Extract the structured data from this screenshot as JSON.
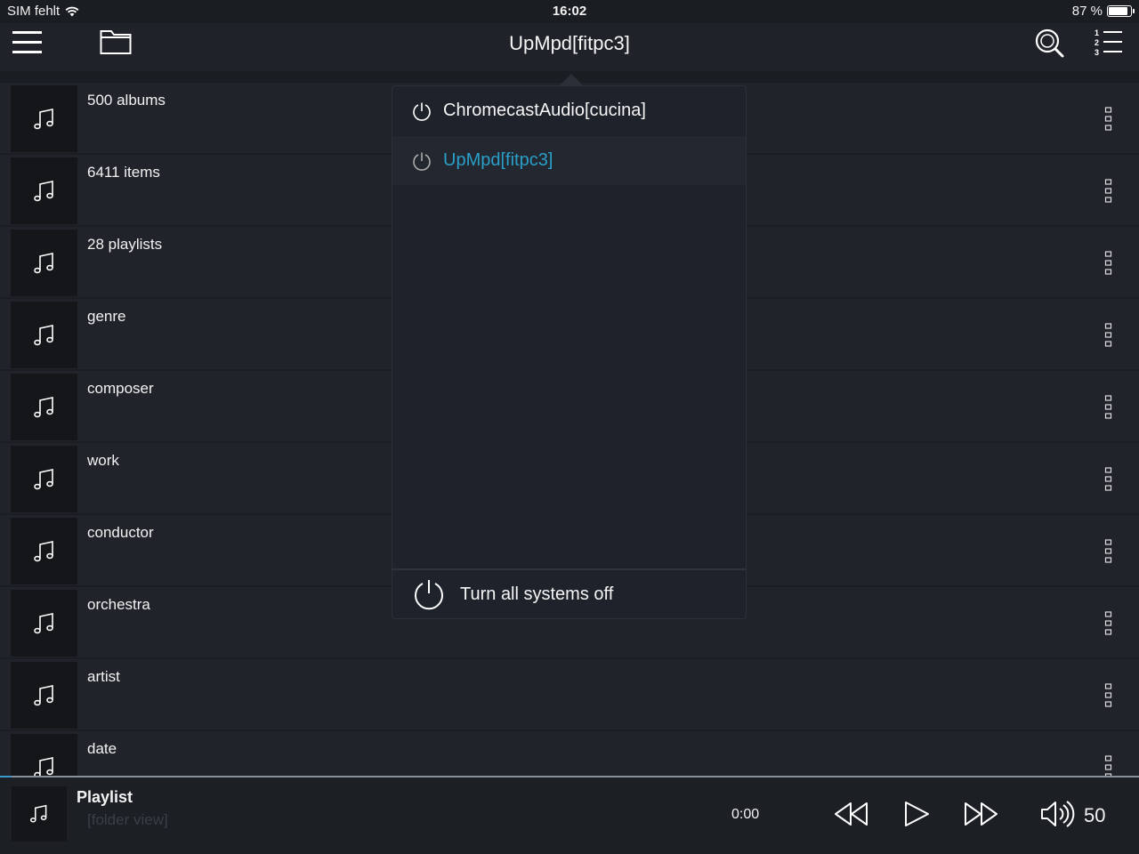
{
  "status_bar": {
    "carrier": "SIM fehlt",
    "time": "16:02",
    "battery": "87 %",
    "battery_level": 0.87
  },
  "navbar": {
    "title": "UpMpd[fitpc3]"
  },
  "list": {
    "items": [
      {
        "label": "500 albums"
      },
      {
        "label": "6411 items"
      },
      {
        "label": "28 playlists"
      },
      {
        "label": "genre"
      },
      {
        "label": "composer"
      },
      {
        "label": "work"
      },
      {
        "label": "conductor"
      },
      {
        "label": "orchestra"
      },
      {
        "label": "artist"
      },
      {
        "label": "date"
      }
    ]
  },
  "popover": {
    "items": [
      {
        "label": "ChromecastAudio[cucina]",
        "selected": false
      },
      {
        "label": "UpMpd[fitpc3]",
        "selected": true
      }
    ],
    "footer": "Turn all systems off"
  },
  "player": {
    "title": "Playlist",
    "subtitle": "[folder view]",
    "time": "0:00",
    "volume": "50",
    "progress": 0.01
  },
  "colors": {
    "accent": "#2a9fc9",
    "background": "#1a1d22",
    "row": "#20242a",
    "thumb": "#14161a",
    "popover": "#1e222a"
  }
}
